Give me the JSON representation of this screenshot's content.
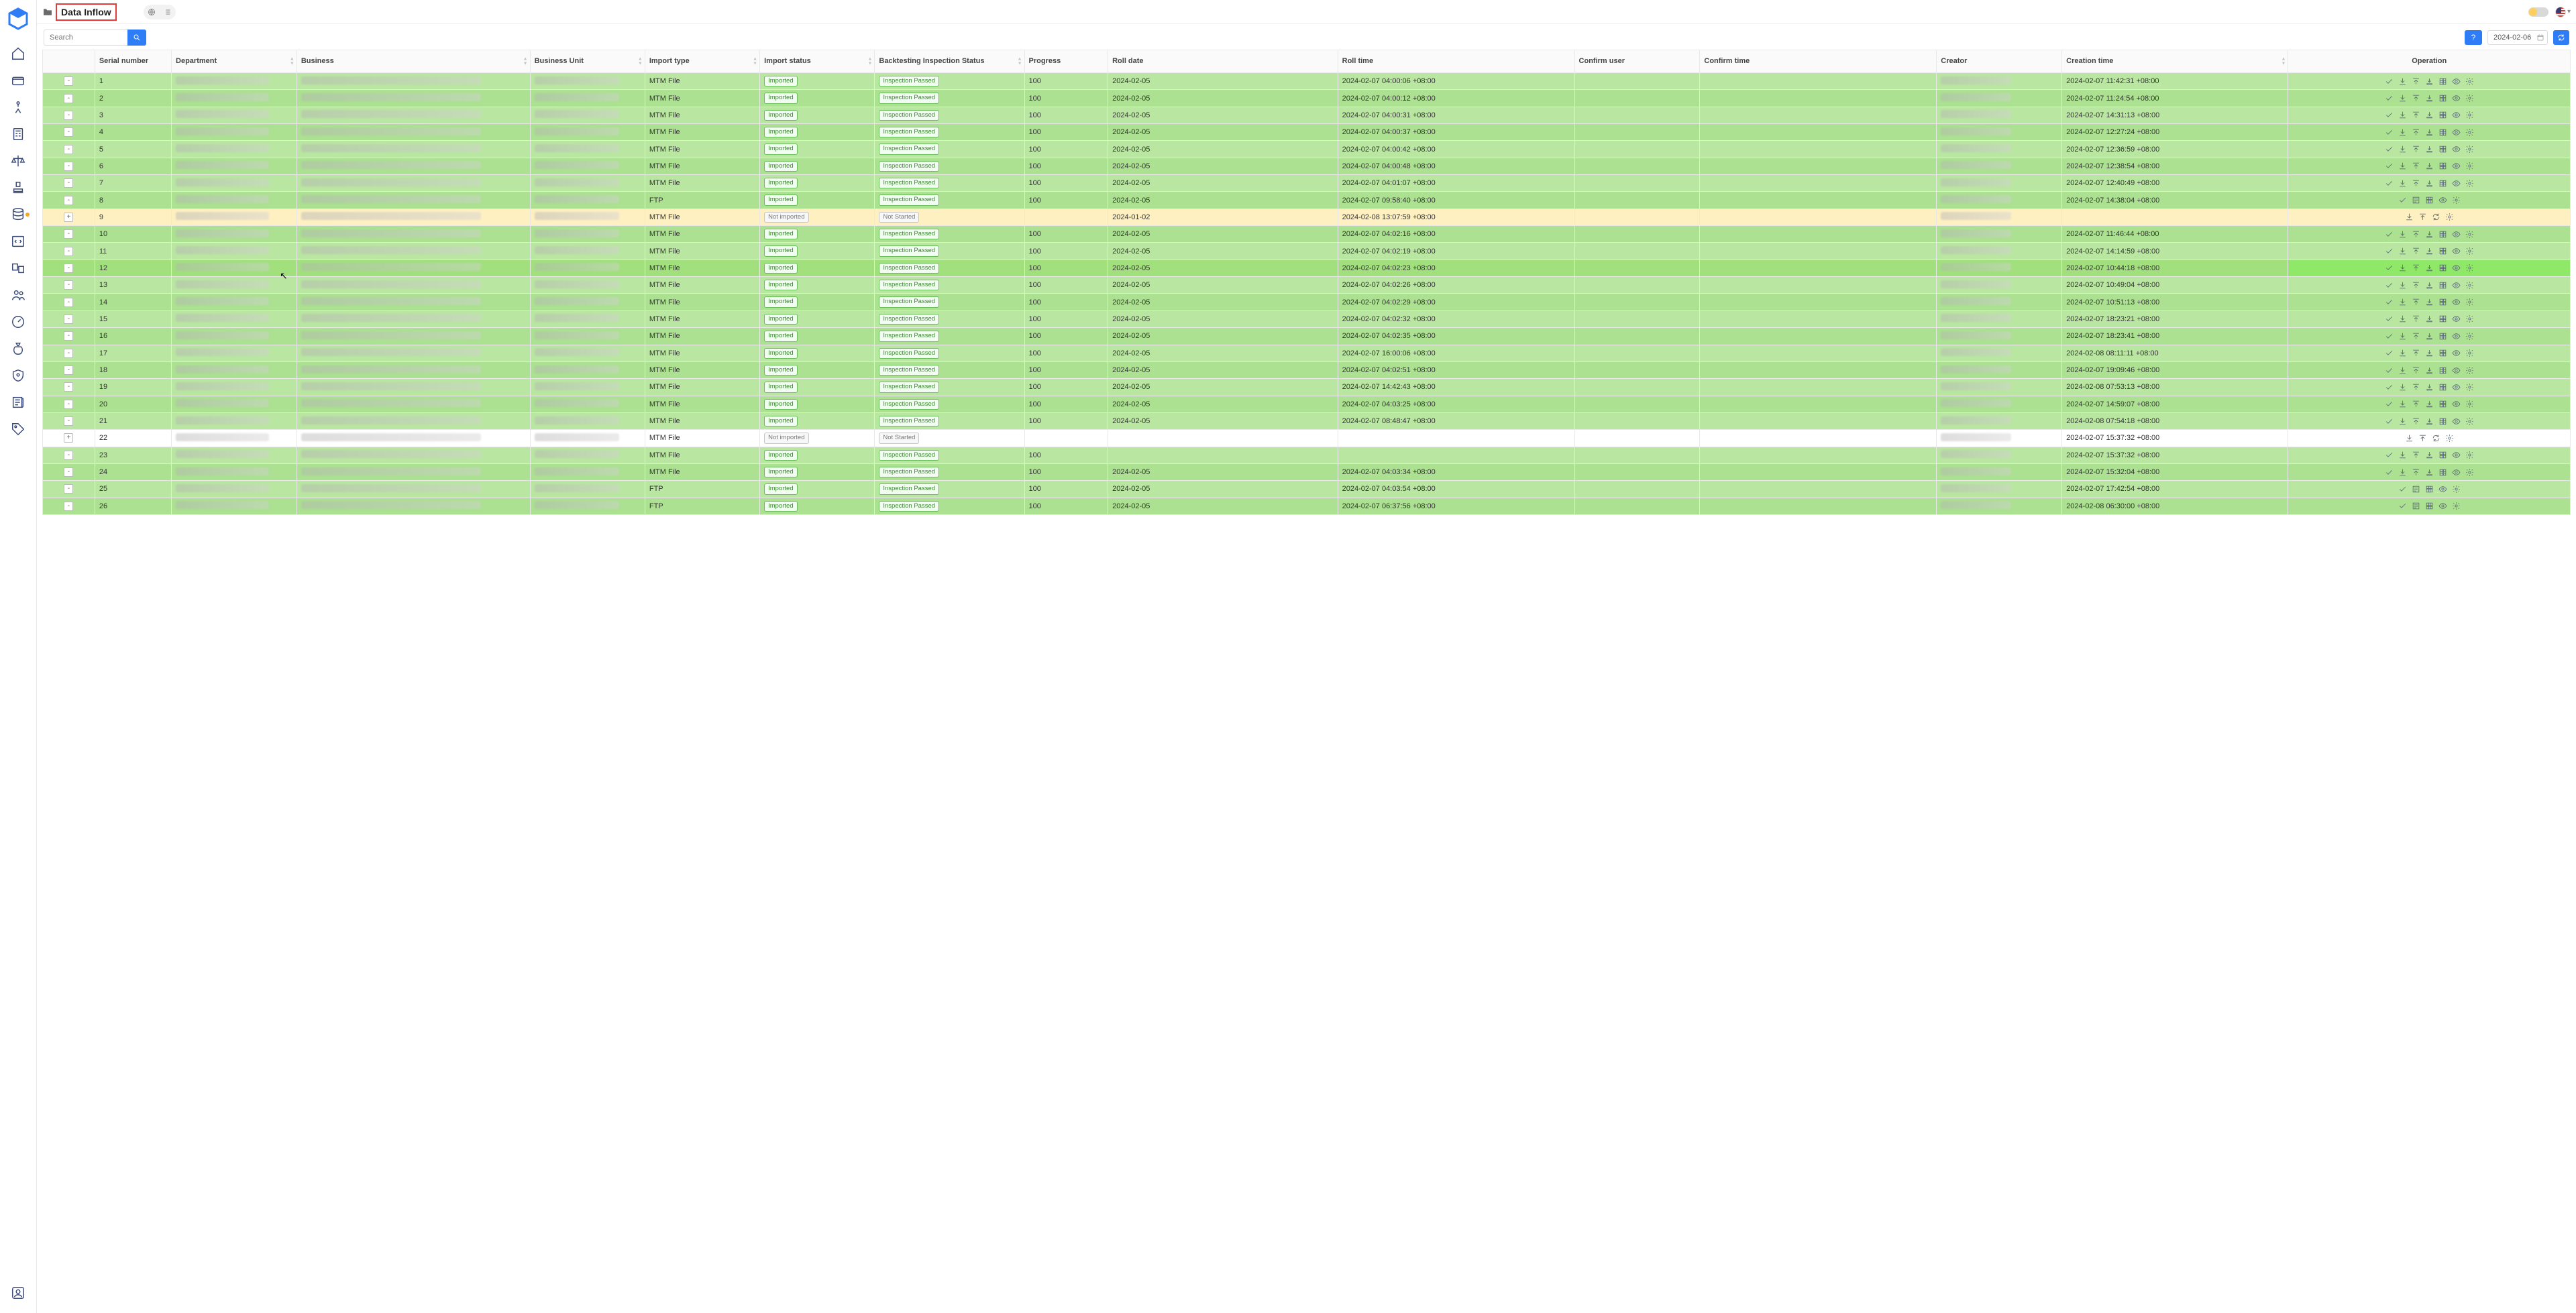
{
  "page_title": "Data Inflow",
  "search_placeholder": "Search",
  "date_value": "2024-02-06",
  "help_label": "?",
  "columns": {
    "sn": "Serial number",
    "dept": "Department",
    "biz": "Business",
    "bu": "Business Unit",
    "itype": "Import type",
    "istat": "Import status",
    "bstat": "Backtesting Inspection Status",
    "prog": "Progress",
    "rdate": "Roll date",
    "rtime": "Roll time",
    "cuser": "Confirm user",
    "ctime": "Confirm time",
    "creator": "Creator",
    "crtime": "Creation time",
    "ops": "Operation"
  },
  "status_labels": {
    "imported": "Imported",
    "not_imported": "Not imported",
    "passed": "Inspection Passed",
    "not_started": "Not Started"
  },
  "import_types": {
    "mtm": "MTM File",
    "ftp": "FTP"
  },
  "rows": [
    {
      "sn": "1",
      "itype": "mtm",
      "istat": "imported",
      "bstat": "passed",
      "prog": "100",
      "rdate": "2024-02-05",
      "rtime": "2024-02-07 04:00:06 +08:00",
      "crtime": "2024-02-07 11:42:31 +08:00",
      "state": "pass",
      "ops": "full",
      "exp": "-"
    },
    {
      "sn": "2",
      "itype": "mtm",
      "istat": "imported",
      "bstat": "passed",
      "prog": "100",
      "rdate": "2024-02-05",
      "rtime": "2024-02-07 04:00:12 +08:00",
      "crtime": "2024-02-07 11:24:54 +08:00",
      "state": "pass-alt",
      "ops": "full",
      "exp": "-"
    },
    {
      "sn": "3",
      "itype": "mtm",
      "istat": "imported",
      "bstat": "passed",
      "prog": "100",
      "rdate": "2024-02-05",
      "rtime": "2024-02-07 04:00:31 +08:00",
      "crtime": "2024-02-07 14:31:13 +08:00",
      "state": "pass",
      "ops": "full",
      "exp": "-"
    },
    {
      "sn": "4",
      "itype": "mtm",
      "istat": "imported",
      "bstat": "passed",
      "prog": "100",
      "rdate": "2024-02-05",
      "rtime": "2024-02-07 04:00:37 +08:00",
      "crtime": "2024-02-07 12:27:24 +08:00",
      "state": "pass-alt",
      "ops": "full",
      "exp": "-"
    },
    {
      "sn": "5",
      "itype": "mtm",
      "istat": "imported",
      "bstat": "passed",
      "prog": "100",
      "rdate": "2024-02-05",
      "rtime": "2024-02-07 04:00:42 +08:00",
      "crtime": "2024-02-07 12:36:59 +08:00",
      "state": "pass",
      "ops": "full",
      "exp": "-"
    },
    {
      "sn": "6",
      "itype": "mtm",
      "istat": "imported",
      "bstat": "passed",
      "prog": "100",
      "rdate": "2024-02-05",
      "rtime": "2024-02-07 04:00:48 +08:00",
      "crtime": "2024-02-07 12:38:54 +08:00",
      "state": "pass-alt",
      "ops": "full",
      "exp": "-"
    },
    {
      "sn": "7",
      "itype": "mtm",
      "istat": "imported",
      "bstat": "passed",
      "prog": "100",
      "rdate": "2024-02-05",
      "rtime": "2024-02-07 04:01:07 +08:00",
      "crtime": "2024-02-07 12:40:49 +08:00",
      "state": "pass",
      "ops": "full",
      "exp": "-"
    },
    {
      "sn": "8",
      "itype": "ftp",
      "istat": "imported",
      "bstat": "passed",
      "prog": "100",
      "rdate": "2024-02-05",
      "rtime": "2024-02-07 09:58:40 +08:00",
      "crtime": "2024-02-07 14:38:04 +08:00",
      "state": "pass-alt",
      "ops": "ftp",
      "exp": "-"
    },
    {
      "sn": "9",
      "itype": "mtm",
      "istat": "not_imported",
      "bstat": "not_started",
      "prog": "",
      "rdate": "2024-01-02",
      "rtime": "2024-02-08 13:07:59 +08:00",
      "crtime": "",
      "state": "notimp",
      "ops": "min",
      "exp": "+"
    },
    {
      "sn": "10",
      "itype": "mtm",
      "istat": "imported",
      "bstat": "passed",
      "prog": "100",
      "rdate": "2024-02-05",
      "rtime": "2024-02-07 04:02:16 +08:00",
      "crtime": "2024-02-07 11:46:44 +08:00",
      "state": "pass-alt",
      "ops": "full",
      "exp": "-"
    },
    {
      "sn": "11",
      "itype": "mtm",
      "istat": "imported",
      "bstat": "passed",
      "prog": "100",
      "rdate": "2024-02-05",
      "rtime": "2024-02-07 04:02:19 +08:00",
      "crtime": "2024-02-07 14:14:59 +08:00",
      "state": "pass",
      "ops": "full",
      "exp": "-"
    },
    {
      "sn": "12",
      "itype": "mtm",
      "istat": "imported",
      "bstat": "passed",
      "prog": "100",
      "rdate": "2024-02-05",
      "rtime": "2024-02-07 04:02:23 +08:00",
      "crtime": "2024-02-07 10:44:18 +08:00",
      "state": "highlight",
      "ops": "full",
      "exp": "-"
    },
    {
      "sn": "13",
      "itype": "mtm",
      "istat": "imported",
      "bstat": "passed",
      "prog": "100",
      "rdate": "2024-02-05",
      "rtime": "2024-02-07 04:02:26 +08:00",
      "crtime": "2024-02-07 10:49:04 +08:00",
      "state": "pass",
      "ops": "full",
      "exp": "-"
    },
    {
      "sn": "14",
      "itype": "mtm",
      "istat": "imported",
      "bstat": "passed",
      "prog": "100",
      "rdate": "2024-02-05",
      "rtime": "2024-02-07 04:02:29 +08:00",
      "crtime": "2024-02-07 10:51:13 +08:00",
      "state": "pass-alt",
      "ops": "full",
      "exp": "-"
    },
    {
      "sn": "15",
      "itype": "mtm",
      "istat": "imported",
      "bstat": "passed",
      "prog": "100",
      "rdate": "2024-02-05",
      "rtime": "2024-02-07 04:02:32 +08:00",
      "crtime": "2024-02-07 18:23:21 +08:00",
      "state": "pass",
      "ops": "full",
      "exp": "-"
    },
    {
      "sn": "16",
      "itype": "mtm",
      "istat": "imported",
      "bstat": "passed",
      "prog": "100",
      "rdate": "2024-02-05",
      "rtime": "2024-02-07 04:02:35 +08:00",
      "crtime": "2024-02-07 18:23:41 +08:00",
      "state": "pass-alt",
      "ops": "full",
      "exp": "-"
    },
    {
      "sn": "17",
      "itype": "mtm",
      "istat": "imported",
      "bstat": "passed",
      "prog": "100",
      "rdate": "2024-02-05",
      "rtime": "2024-02-07 16:00:06 +08:00",
      "crtime": "2024-02-08 08:11:11 +08:00",
      "state": "pass",
      "ops": "full",
      "exp": "-"
    },
    {
      "sn": "18",
      "itype": "mtm",
      "istat": "imported",
      "bstat": "passed",
      "prog": "100",
      "rdate": "2024-02-05",
      "rtime": "2024-02-07 04:02:51 +08:00",
      "crtime": "2024-02-07 19:09:46 +08:00",
      "state": "pass-alt",
      "ops": "full",
      "exp": "-"
    },
    {
      "sn": "19",
      "itype": "mtm",
      "istat": "imported",
      "bstat": "passed",
      "prog": "100",
      "rdate": "2024-02-05",
      "rtime": "2024-02-07 14:42:43 +08:00",
      "crtime": "2024-02-08 07:53:13 +08:00",
      "state": "pass",
      "ops": "full",
      "exp": "-"
    },
    {
      "sn": "20",
      "itype": "mtm",
      "istat": "imported",
      "bstat": "passed",
      "prog": "100",
      "rdate": "2024-02-05",
      "rtime": "2024-02-07 04:03:25 +08:00",
      "crtime": "2024-02-07 14:59:07 +08:00",
      "state": "pass-alt",
      "ops": "full",
      "exp": "-"
    },
    {
      "sn": "21",
      "itype": "mtm",
      "istat": "imported",
      "bstat": "passed",
      "prog": "100",
      "rdate": "2024-02-05",
      "rtime": "2024-02-07 08:48:47 +08:00",
      "crtime": "2024-02-08 07:54:18 +08:00",
      "state": "pass",
      "ops": "full",
      "exp": "-"
    },
    {
      "sn": "22",
      "itype": "mtm",
      "istat": "not_imported",
      "bstat": "not_started",
      "prog": "",
      "rdate": "",
      "rtime": "",
      "crtime": "2024-02-07 15:37:32 +08:00",
      "state": "notimp2",
      "ops": "min",
      "exp": "+"
    },
    {
      "sn": "23",
      "itype": "mtm",
      "istat": "imported",
      "bstat": "passed",
      "prog": "100",
      "rdate": "",
      "rtime": "",
      "crtime": "2024-02-07 15:37:32 +08:00",
      "state": "pass",
      "ops": "full",
      "exp": "-"
    },
    {
      "sn": "24",
      "itype": "mtm",
      "istat": "imported",
      "bstat": "passed",
      "prog": "100",
      "rdate": "2024-02-05",
      "rtime": "2024-02-07 04:03:34 +08:00",
      "crtime": "2024-02-07 15:32:04 +08:00",
      "state": "pass-alt",
      "ops": "full",
      "exp": "-"
    },
    {
      "sn": "25",
      "itype": "ftp",
      "istat": "imported",
      "bstat": "passed",
      "prog": "100",
      "rdate": "2024-02-05",
      "rtime": "2024-02-07 04:03:54 +08:00",
      "crtime": "2024-02-07 17:42:54 +08:00",
      "state": "pass",
      "ops": "ftp",
      "exp": "-"
    },
    {
      "sn": "26",
      "itype": "ftp",
      "istat": "imported",
      "bstat": "passed",
      "prog": "100",
      "rdate": "2024-02-05",
      "rtime": "2024-02-07 06:37:56 +08:00",
      "crtime": "2024-02-08 06:30:00 +08:00",
      "state": "pass-alt",
      "ops": "ftp",
      "exp": "-"
    }
  ]
}
